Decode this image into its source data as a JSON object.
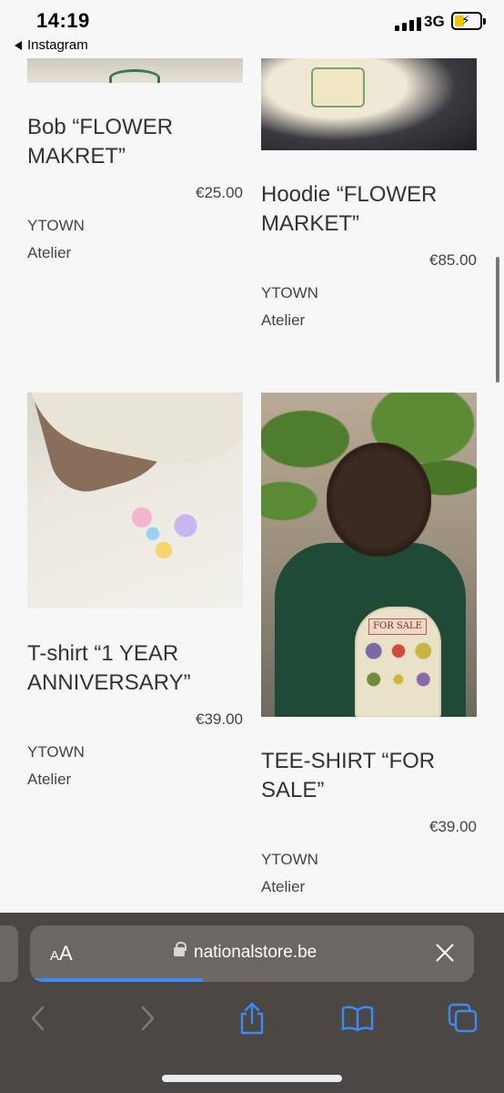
{
  "status_bar": {
    "time": "14:19",
    "back_app": "Instagram",
    "network": "3G",
    "battery_level": 0.4
  },
  "products": [
    {
      "title": "Bob “FLOWER MAKRET”",
      "price": "€25.00",
      "vendor_line1": "YTOWN",
      "vendor_line2": "Atelier"
    },
    {
      "title": "Hoodie “FLOWER MARKET”",
      "price": "€85.00",
      "vendor_line1": "YTOWN",
      "vendor_line2": "Atelier"
    },
    {
      "title": "T-shirt “1 YEAR ANNIVERSARY”",
      "price": "€39.00",
      "vendor_line1": "YTOWN",
      "vendor_line2": "Atelier"
    },
    {
      "title": "TEE-SHIRT “FOR SALE”",
      "price": "€39.00",
      "vendor_line1": "YTOWN",
      "vendor_line2": "Atelier",
      "print_text": "FOR SALE"
    }
  ],
  "browser": {
    "text_size_label_small": "A",
    "text_size_label_large": "A",
    "url": "nationalstore.be",
    "load_progress": 0.39,
    "accent_color": "#3d8bf2"
  },
  "toolbar_icons": [
    "back-icon",
    "forward-icon",
    "share-icon",
    "bookmarks-icon",
    "tabs-icon"
  ]
}
